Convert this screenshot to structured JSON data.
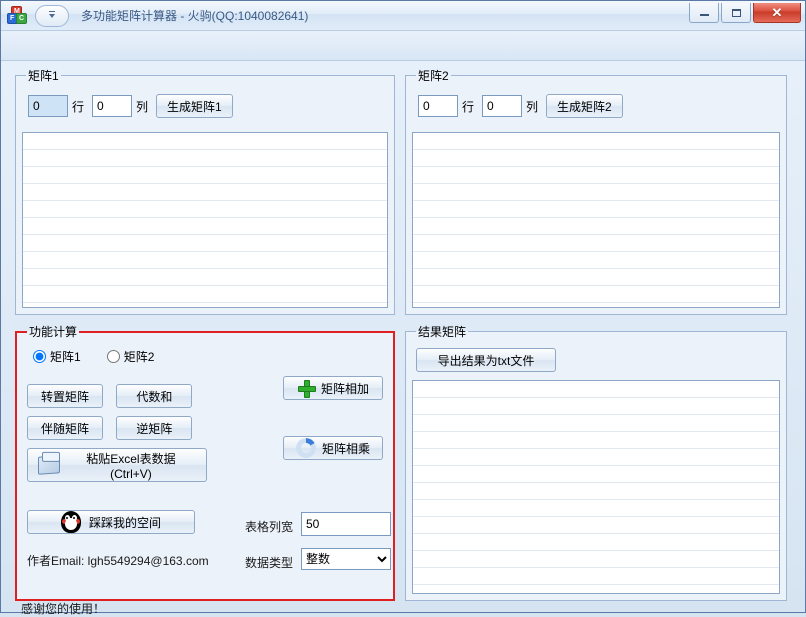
{
  "window": {
    "title": "多功能矩阵计算器 - 火驹(QQ:1040082641)"
  },
  "matrix1": {
    "legend": "矩阵1",
    "rows_value": "0",
    "rows_label": "行",
    "cols_value": "0",
    "cols_label": "列",
    "generate_label": "生成矩阵1"
  },
  "matrix2": {
    "legend": "矩阵2",
    "rows_value": "0",
    "rows_label": "行",
    "cols_value": "0",
    "cols_label": "列",
    "generate_label": "生成矩阵2"
  },
  "calc": {
    "legend": "功能计算",
    "radio_m1": "矩阵1",
    "radio_m2": "矩阵2",
    "transpose": "转置矩阵",
    "cofactor_sum": "代数和",
    "adjugate": "伴随矩阵",
    "inverse": "逆矩阵",
    "paste_excel": "粘贴Excel表数据(Ctrl+V)",
    "add": "矩阵相加",
    "multiply": "矩阵相乘",
    "qzone": "踩踩我的空间",
    "col_width_label": "表格列宽",
    "col_width_value": "50",
    "data_type_label": "数据类型",
    "data_type_value": "整数",
    "data_type_options": [
      "整数"
    ]
  },
  "result": {
    "legend": "结果矩阵",
    "export_label": "导出结果为txt文件"
  },
  "footer": {
    "email": "作者Email: lgh5549294@163.com",
    "thanks": "感谢您的使用！"
  }
}
